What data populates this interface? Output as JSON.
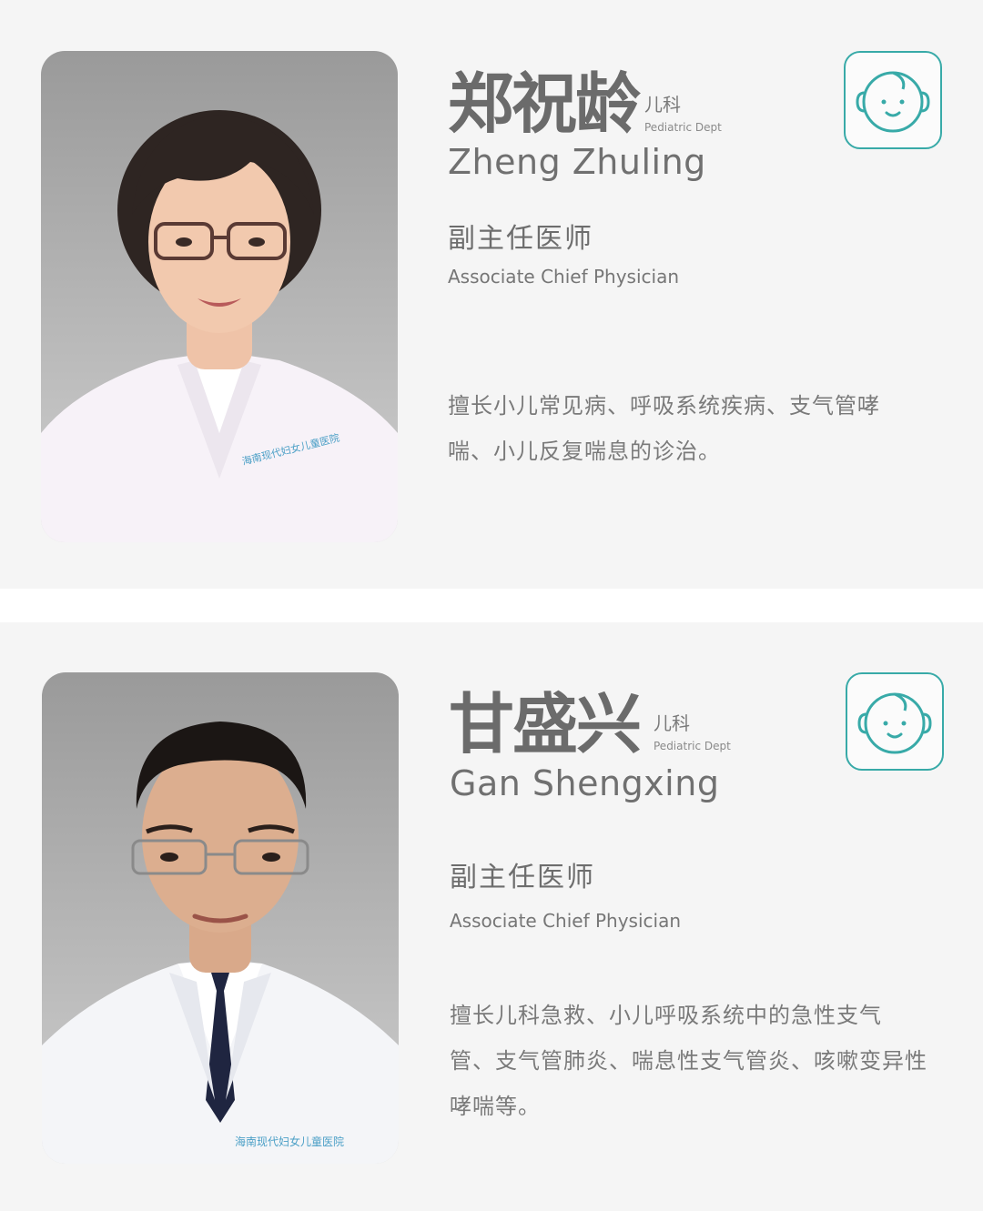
{
  "doctors": [
    {
      "name_zh": "郑祝龄",
      "dept_zh": "儿科",
      "dept_en": "Pediatric Dept",
      "name_en": "Zheng Zhuling",
      "title_zh": "副主任医师",
      "title_en": "Associate Chief Physician",
      "desc_lines": [
        "擅长小儿常见病、呼吸系统疾病、支气管哮",
        "喘、小儿反复喘息的诊治。"
      ],
      "badge_icon": "baby-face-icon",
      "photo_logo": "海南现代妇女儿童医院"
    },
    {
      "name_zh": "甘盛兴",
      "dept_zh": "儿科",
      "dept_en": "Pediatric Dept",
      "name_en": "Gan Shengxing",
      "title_zh": "副主任医师",
      "title_en": "Associate Chief Physician",
      "desc_lines": [
        "擅长儿科急救、小儿呼吸系统中的急性支气",
        "管、支气管肺炎、喘息性支气管炎、咳嗽变异性",
        "哮喘等。"
      ],
      "badge_icon": "baby-face-icon",
      "photo_logo": "海南现代妇女儿童医院"
    }
  ],
  "colors": {
    "accent": "#38aaa8",
    "card_bg": "#f5f5f5",
    "text": "#6b6b6b"
  }
}
